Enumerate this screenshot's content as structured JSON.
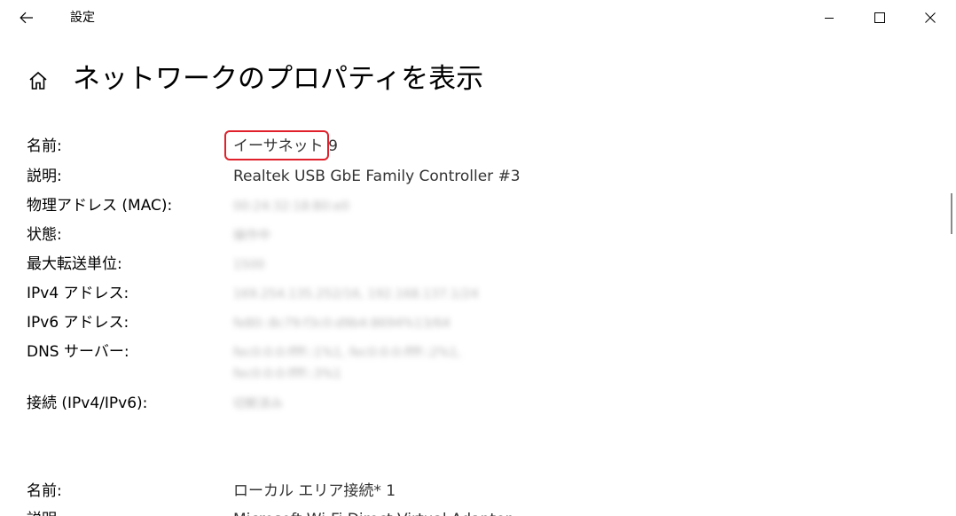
{
  "window": {
    "title": "設定",
    "back_icon": "arrow-left-icon",
    "controls": {
      "minimize_icon": "minimize-icon",
      "maximize_icon": "maximize-icon",
      "close_icon": "close-icon"
    }
  },
  "page": {
    "home_icon": "home-icon",
    "title": "ネットワークのプロパティを表示"
  },
  "adapter1": {
    "name_label": "名前:",
    "name_value": "イーサネット 9",
    "desc_label": "説明:",
    "desc_value": "Realtek USB GbE Family Controller #3",
    "mac_label": "物理アドレス (MAC):",
    "mac_value": "00:24:32:18:B0:e0",
    "state_label": "状態:",
    "state_value": "操作中",
    "mtu_label": "最大転送単位:",
    "mtu_value": "1500",
    "ipv4_label": "IPv4 アドレス:",
    "ipv4_value": "169.254.135.252/16, 192.168.137.1/24",
    "ipv6_label": "IPv6 アドレス:",
    "ipv6_value": "fe80::8c79:f3c0:d9b4:8694%13/64",
    "dns_label": "DNS サーバー:",
    "dns_value_line1": "fec0:0:0:ffff::1%1, fec0:0:0:ffff::2%1,",
    "dns_value_line2": "fec0:0:0:ffff::3%1",
    "conn_label": "接続 (IPv4/IPv6):",
    "conn_value": "切断済み"
  },
  "adapter2": {
    "name_label": "名前:",
    "name_value": "ローカル エリア接続* 1",
    "desc_label": "説明:",
    "desc_value": "Microsoft Wi-Fi Direct Virtual Adapter"
  },
  "accent": {
    "highlight_color": "#e0202a"
  }
}
